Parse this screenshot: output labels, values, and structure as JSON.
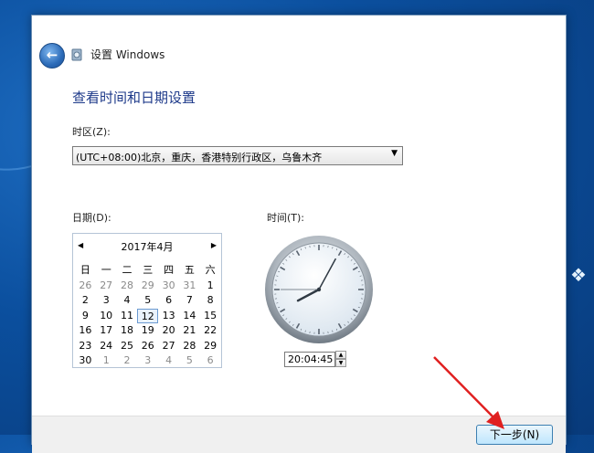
{
  "window": {
    "title": "设置 Windows"
  },
  "page": {
    "heading": "查看时间和日期设置",
    "timezone_label": "时区(Z):",
    "timezone_value": "(UTC+08:00)北京，重庆，香港特别行政区，乌鲁木齐",
    "date_label": "日期(D):",
    "time_label": "时间(T):"
  },
  "calendar": {
    "month_title": "2017年4月",
    "weekdays": [
      "日",
      "一",
      "二",
      "三",
      "四",
      "五",
      "六"
    ],
    "weeks": [
      [
        "26",
        "27",
        "28",
        "29",
        "30",
        "31",
        "1"
      ],
      [
        "2",
        "3",
        "4",
        "5",
        "6",
        "7",
        "8"
      ],
      [
        "9",
        "10",
        "11",
        "12",
        "13",
        "14",
        "15"
      ],
      [
        "16",
        "17",
        "18",
        "19",
        "20",
        "21",
        "22"
      ],
      [
        "23",
        "24",
        "25",
        "26",
        "27",
        "28",
        "29"
      ],
      [
        "30",
        "1",
        "2",
        "3",
        "4",
        "5",
        "6"
      ]
    ],
    "selected_day": "12"
  },
  "time": {
    "value": "20:04:45",
    "hour": 20,
    "minute": 4,
    "second": 45
  },
  "footer": {
    "next_label": "下一步(N)"
  },
  "colors": {
    "heading": "#1e3a8a",
    "annotation_arrow": "#e02020",
    "desktop": "#0b4f9e"
  },
  "icons": {
    "back": "back-arrow-icon",
    "title": "setup-disc-icon",
    "prev_month": "triangle-left-icon",
    "next_month": "triangle-right-icon",
    "dropdown": "triangle-down-icon",
    "windows_logo": "windows-logo-icon"
  }
}
